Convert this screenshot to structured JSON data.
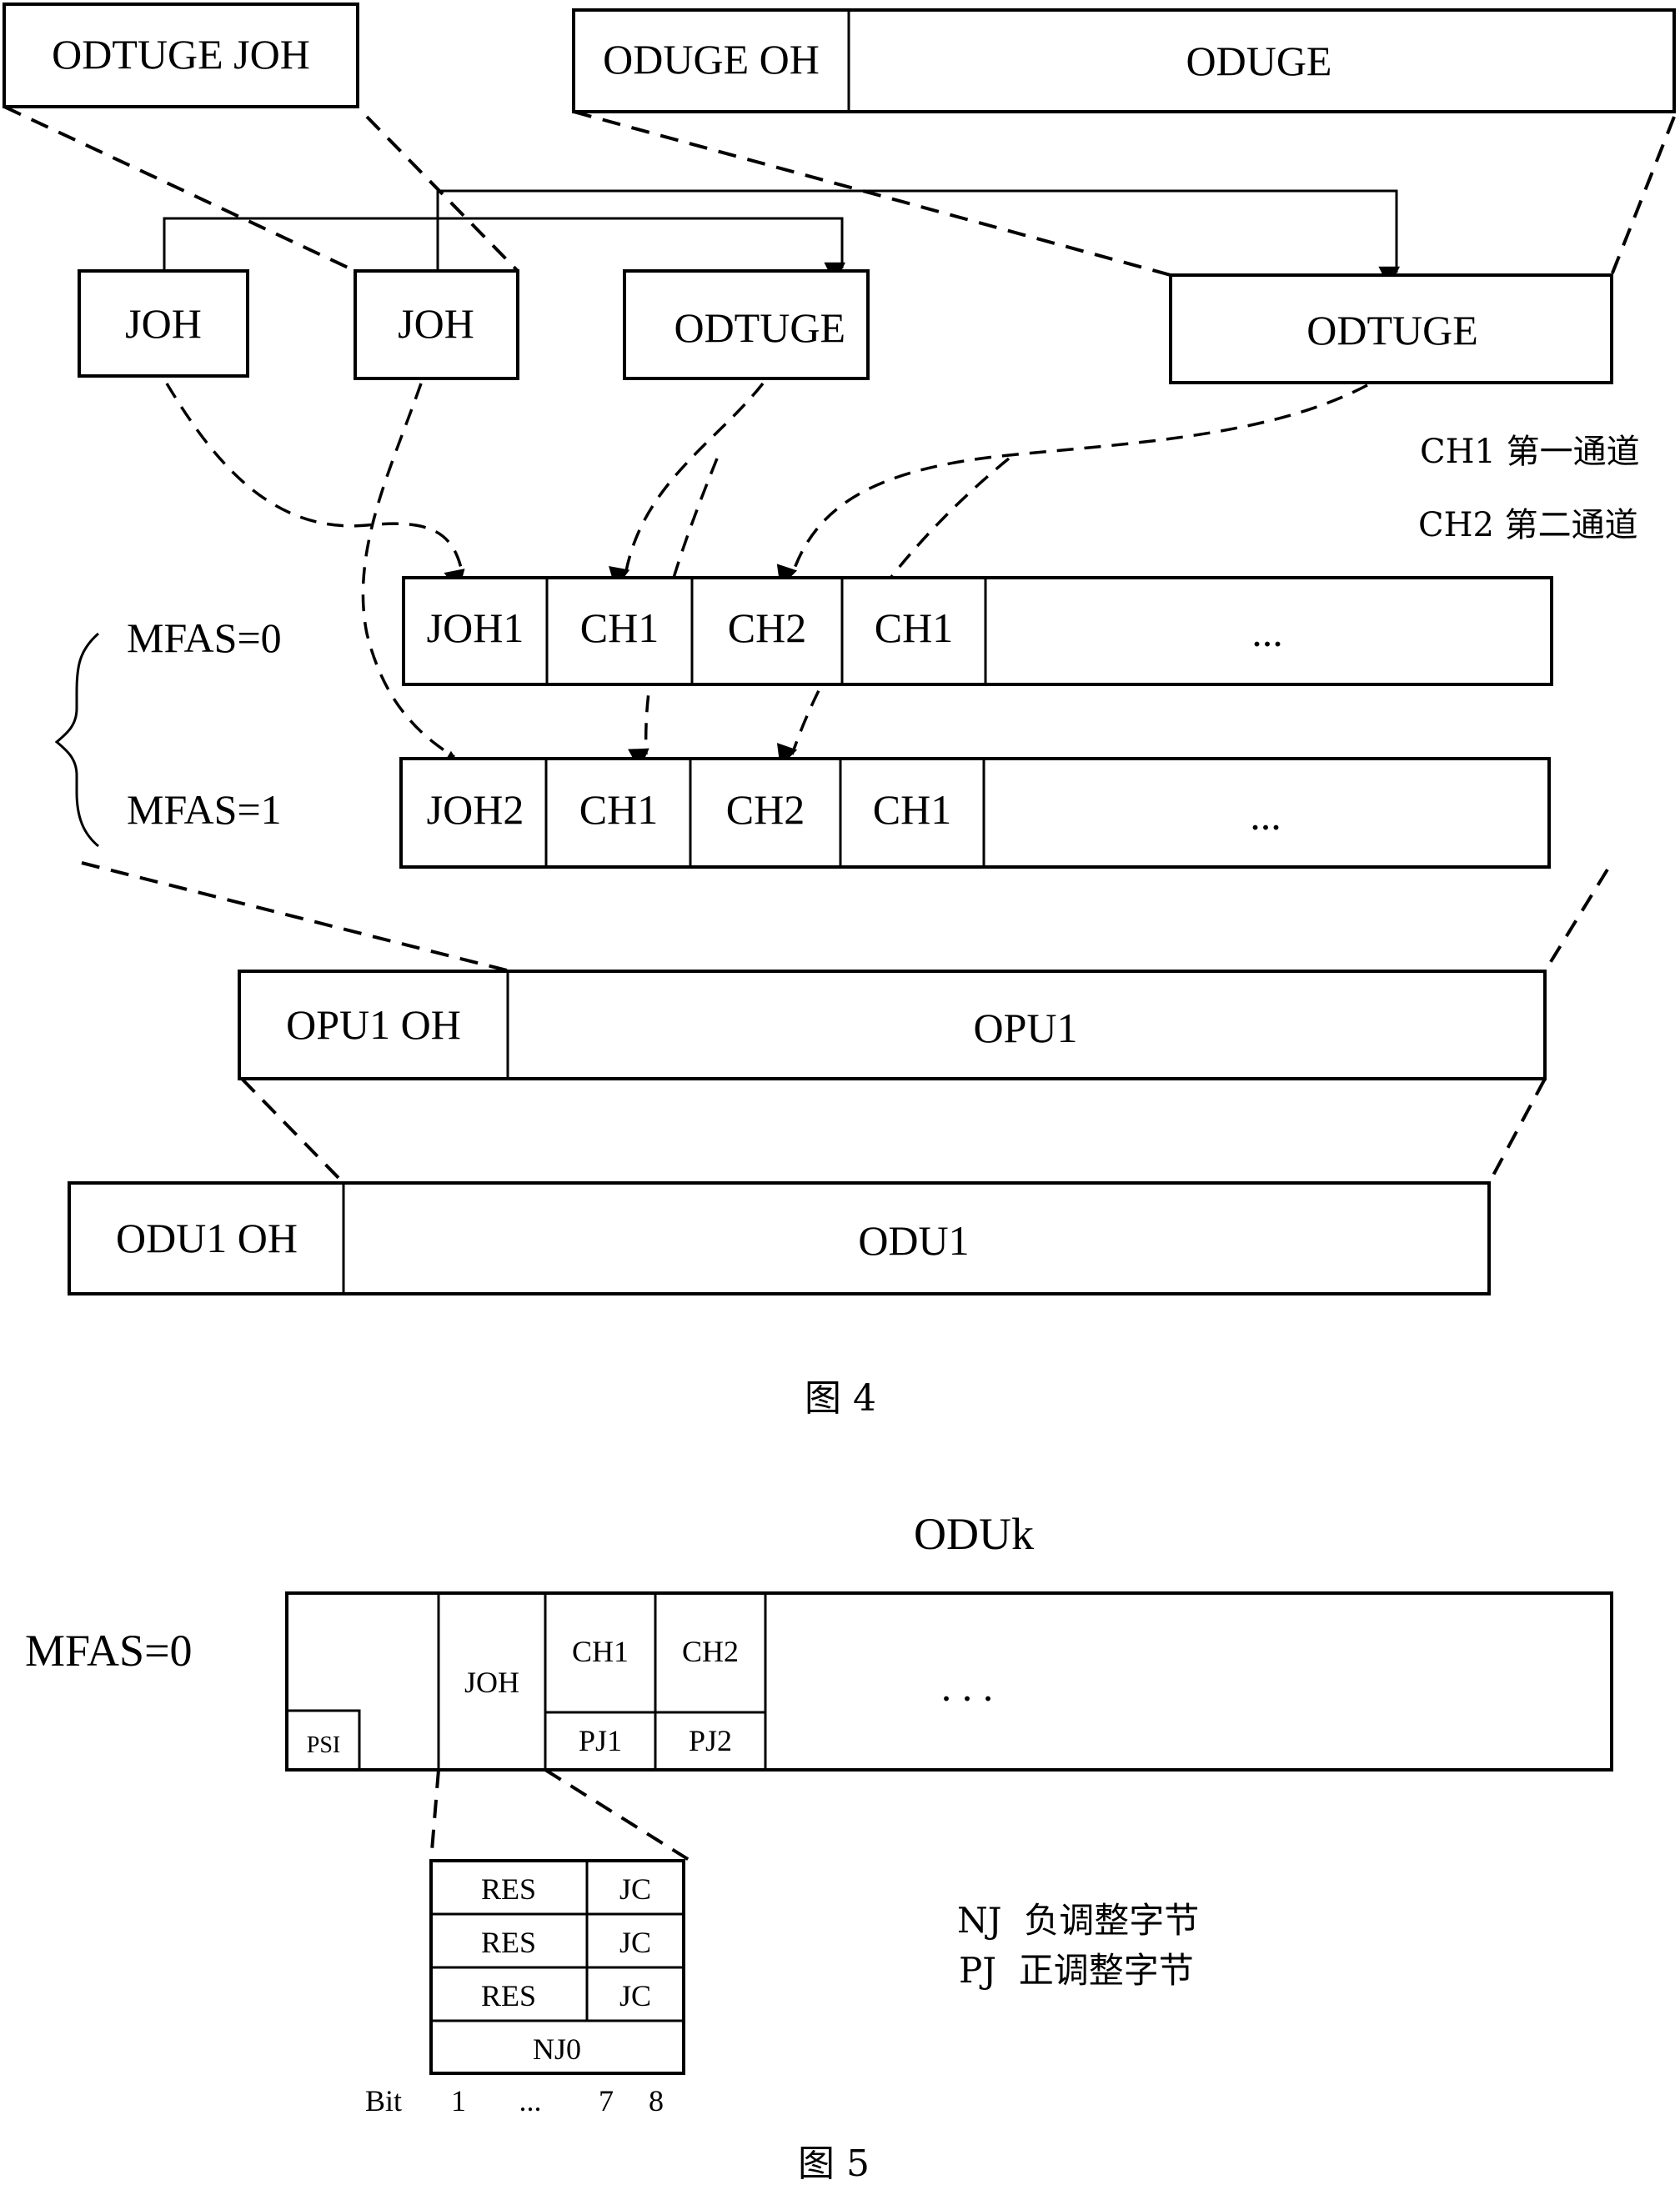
{
  "figure4": {
    "caption": "图 4",
    "top_left_box": "ODTUGE JOH",
    "top_right_oh": "ODUGE OH",
    "top_right_payload": "ODUGE",
    "joh_a": "JOH",
    "joh_b": "JOH",
    "odtuge_a": "ODTUGE",
    "odtuge_b": "ODTUGE",
    "legend": [
      "CH1 第一通道",
      "CH2 第二通道"
    ],
    "mfas0": "MFAS=0",
    "mfas1": "MFAS=1",
    "row0": [
      "JOH1",
      "CH1",
      "CH2",
      "CH1",
      "..."
    ],
    "row1": [
      "JOH2",
      "CH1",
      "CH2",
      "CH1",
      "..."
    ],
    "opu_oh": "OPU1 OH",
    "opu": "OPU1",
    "odu_oh": "ODU1 OH",
    "odu": "ODU1"
  },
  "figure5": {
    "caption": "图 5",
    "title": "ODUk",
    "mfas": "MFAS=0",
    "psi": "PSI",
    "joh": "JOH",
    "ch1": "CH1",
    "ch2": "CH2",
    "pj1": "PJ1",
    "pj2": "PJ2",
    "ellipsis": ". . .",
    "joh_table": {
      "rows": [
        [
          "RES",
          "JC"
        ],
        [
          "RES",
          "JC"
        ],
        [
          "RES",
          "JC"
        ]
      ],
      "last_row": "NJ0",
      "bit_label": "Bit",
      "bit_ticks": [
        "1",
        "...",
        "7",
        "8"
      ]
    },
    "legend": [
      "NJ  负调整字节",
      "PJ  正调整字节"
    ]
  }
}
